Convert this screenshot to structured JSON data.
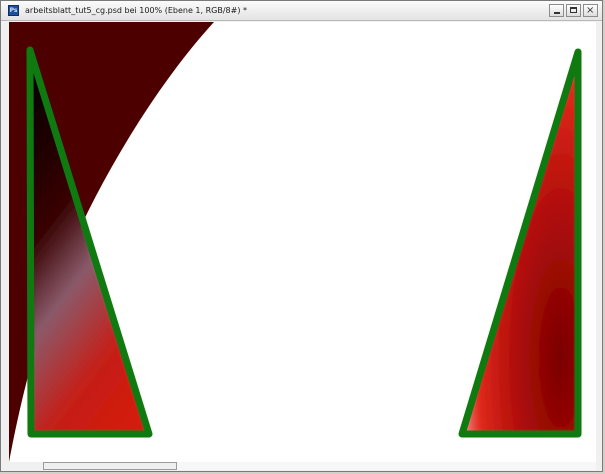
{
  "window": {
    "title": "arbeitsblatt_tut5_cg.psd bei 100% (Ebene 1, RGB/8#) *",
    "app_icon_label": "Ps"
  },
  "controls": {
    "minimize": "minimize-icon",
    "restore": "restore-icon",
    "close_glyph": "×"
  },
  "canvas": {
    "background_color": "#ffffff",
    "shape_color": "#4d0000",
    "outline_color": "#0f7a10",
    "fill_red": "#d11a0a",
    "fill_dark": "#120000"
  }
}
